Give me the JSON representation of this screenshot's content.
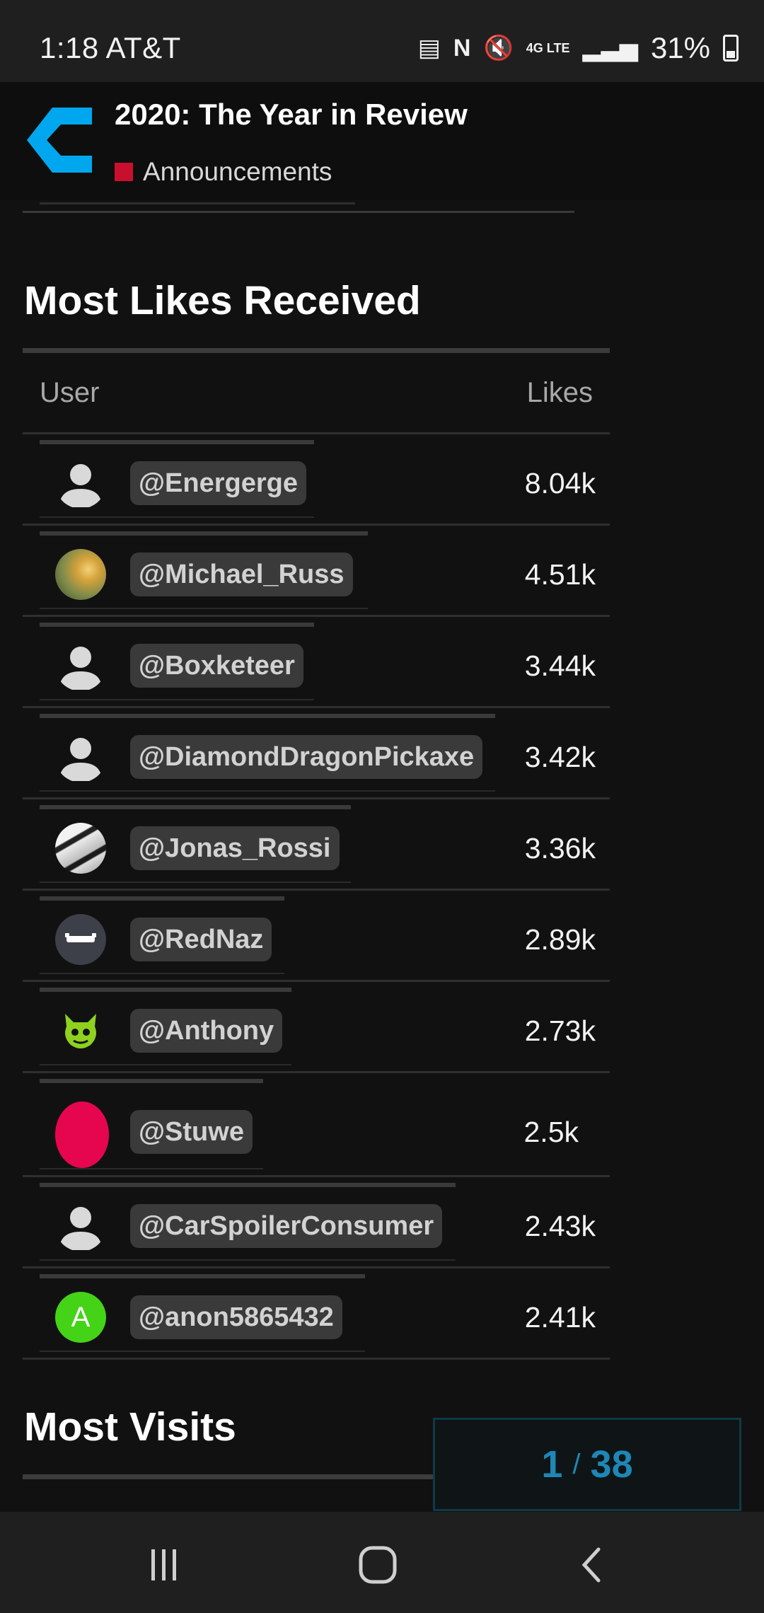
{
  "status_bar": {
    "time": "1:18 AT&T",
    "network": "4G LTE",
    "battery": "31%"
  },
  "topic": {
    "title": "2020: The Year in Review",
    "category": "Announcements",
    "category_color": "#c8102e",
    "logo_color": "#00a7ef"
  },
  "likes_section": {
    "title": "Most Likes Received",
    "col_user": "User",
    "col_likes": "Likes",
    "rows": [
      {
        "user": "@Energerge",
        "likes": "8.04k",
        "avatar": "default-user-icon"
      },
      {
        "user": "@Michael_Russ",
        "likes": "4.51k",
        "avatar": "photo-avatar"
      },
      {
        "user": "@Boxketeer",
        "likes": "3.44k",
        "avatar": "default-user-icon"
      },
      {
        "user": "@DiamondDragonPickaxe",
        "likes": "3.42k",
        "avatar": "default-user-icon"
      },
      {
        "user": "@Jonas_Rossi",
        "likes": "3.36k",
        "avatar": "photo-avatar"
      },
      {
        "user": "@RedNaz",
        "likes": "2.89k",
        "avatar": "custom-avatar"
      },
      {
        "user": "@Anthony",
        "likes": "2.73k",
        "avatar": "custom-avatar"
      },
      {
        "user": "@Stuwe",
        "likes": "2.5k",
        "avatar": "pink-avatar"
      },
      {
        "user": "@CarSpoilerConsumer",
        "likes": "2.43k",
        "avatar": "default-user-icon"
      },
      {
        "user": "@anon5865432",
        "likes": "2.41k",
        "avatar": "letter-avatar",
        "avatar_letter": "A"
      }
    ]
  },
  "visits_section": {
    "title": "Most Visits"
  },
  "progress": {
    "current": "1",
    "separator": "/",
    "total": "38"
  }
}
